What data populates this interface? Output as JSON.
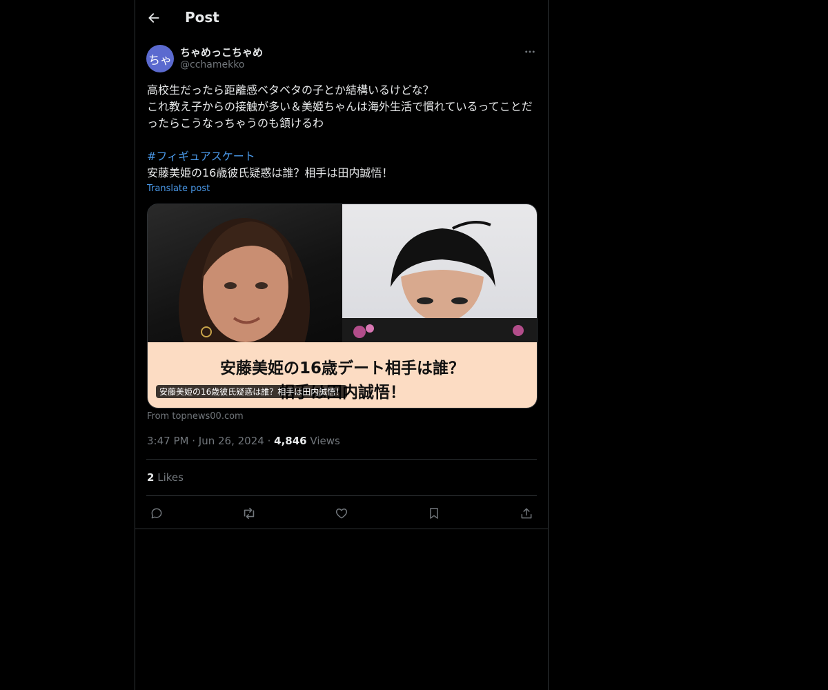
{
  "header": {
    "title": "Post"
  },
  "author": {
    "avatar_text": "ちゃ",
    "display_name": "ちゃめっこちゃめ",
    "handle": "@cchamekko"
  },
  "post": {
    "lines": [
      "高校生だったら距離感ベタベタの子とか結構いるけどな？",
      "これ教え子からの接触が多い＆美姫ちゃんは海外生活で慣れているってことだったらこうなっちゃうのも頷けるわ"
    ],
    "hashtag": "#フィギュアスケート",
    "article_line": "安藤美姫の16歳彼氏疑惑は誰？相手は田内誠悟！",
    "translate_label": "Translate post"
  },
  "card": {
    "banner_line1": "安藤美姫の16歳デート相手は誰？",
    "banner_line2": "相手は田内誠悟！",
    "caption": "安藤美姫の16歳彼氏疑惑は誰？相手は田内誠悟！",
    "source": "From topnews00.com"
  },
  "meta": {
    "time": "3:47 PM",
    "date": "Jun 26, 2024",
    "views_count": "4,846",
    "views_label": "Views",
    "separator": "·"
  },
  "stats": {
    "likes_count": "2",
    "likes_label": "Likes"
  },
  "icons": {
    "back": "arrow-left-icon",
    "more": "more-horizontal-icon",
    "reply": "reply-icon",
    "repost": "repost-icon",
    "like": "heart-icon",
    "bookmark": "bookmark-icon",
    "share": "share-icon"
  },
  "colors": {
    "background": "#000000",
    "text": "#e7e9ea",
    "muted": "#71767b",
    "link": "#4a99e9",
    "border": "#2f3336",
    "avatar": "#5b6acf",
    "banner": "#fcdcc3"
  }
}
